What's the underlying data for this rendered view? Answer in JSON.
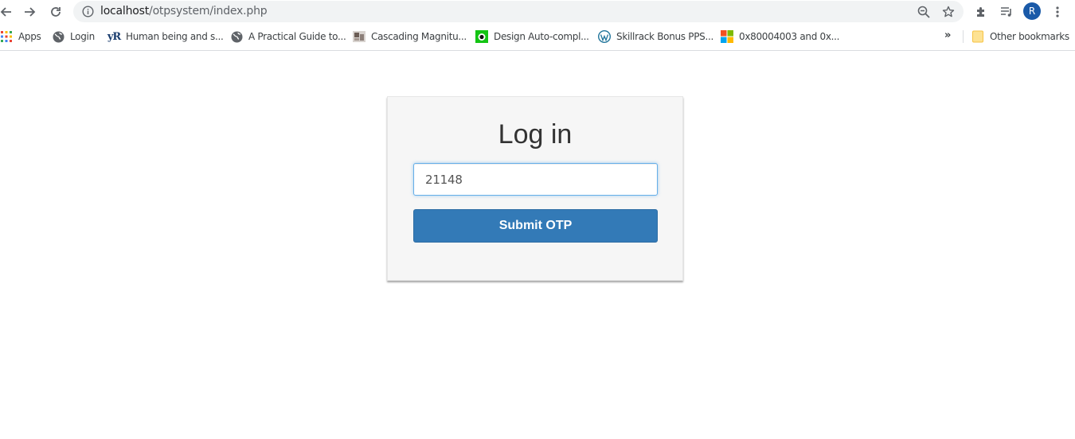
{
  "browser": {
    "url_host": "localhost",
    "url_path": "/otpsystem/index.php",
    "profile_initial": "R",
    "icons": {
      "back": "arrow-left-icon",
      "forward": "arrow-right-icon",
      "reload": "reload-icon",
      "site_info": "info-icon",
      "zoom": "zoom-out-icon",
      "bookmark": "star-icon",
      "extensions": "puzzle-icon",
      "media": "media-playlist-icon",
      "menu": "vertical-dots-icon"
    },
    "accent_color": "#1a5aa8"
  },
  "bookmarks": {
    "items": [
      {
        "label": "Apps",
        "icon": "apps-grid-icon"
      },
      {
        "label": "Login",
        "icon": "globe-icon"
      },
      {
        "label": "Human being and s...",
        "icon": "yr-logo-icon"
      },
      {
        "label": "A Practical Guide to...",
        "icon": "globe-icon"
      },
      {
        "label": "Cascading Magnitu...",
        "icon": "site-thumbnail-icon"
      },
      {
        "label": "Design Auto-compl...",
        "icon": "green-site-icon"
      },
      {
        "label": "Skillrack Bonus PPS...",
        "icon": "wordpress-icon"
      },
      {
        "label": "0x80004003 and 0x...",
        "icon": "windows-logo-icon"
      }
    ],
    "overflow_label": "»",
    "other_label": "Other bookmarks"
  },
  "login": {
    "title": "Log in",
    "otp_value": "21148",
    "submit_label": "Submit OTP",
    "button_color": "#337ab7",
    "card_color": "#f6f6f6"
  }
}
